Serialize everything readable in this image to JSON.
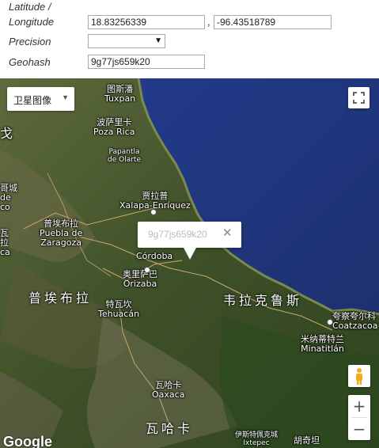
{
  "form": {
    "latlon_label_line1": "Latitude /",
    "latlon_label_line2": "Longitude",
    "latitude": "18.83256339",
    "separator": ",",
    "longitude": "-96.43518789",
    "precision_label": "Precision",
    "precision_value": "",
    "geohash_label": "Geohash",
    "geohash": "9g77js659k20"
  },
  "map": {
    "map_type_label": "卫星图像",
    "info_window_text": "9g77js659k20",
    "zoom_in": "+",
    "zoom_out": "−",
    "attribution": "Google",
    "places": {
      "tuxpan": "图斯潘\nTuxpan",
      "poza_rica": "波萨里卡\nPoza Rica",
      "papantla": "Papantla\nde Olarte",
      "xalapa": "贾拉普\nXalapa-Enríquez",
      "puebla": "普埃布拉\nPuebla de\nZaragoza",
      "cordoba": "Córdoba",
      "orizaba": "奥里萨巴\nOrizaba",
      "tehuacan": "特瓦坎\nTehuacán",
      "coatzacoalcos": "夸察夸尔科\nCoatzacoa",
      "minatitlan": "米纳蒂特兰\nMinatitlán",
      "oaxaca": "瓦哈卡\nOaxaca",
      "ixtepec": "伊斯特佩克城\nIxtepec",
      "juchitan": "胡奇坦",
      "west_edge_1": "戈",
      "west_edge_2": "哥城\nde\nco",
      "west_edge_3": "瓦\n拉\nca"
    },
    "regions": {
      "puebla": "普埃布拉",
      "veracruz": "韦拉克鲁斯",
      "oaxaca": "瓦哈卡"
    }
  }
}
